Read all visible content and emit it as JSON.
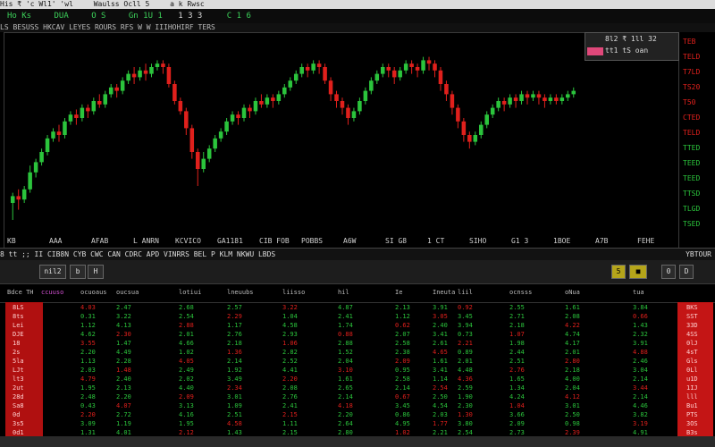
{
  "window": {
    "title_left": "His ₹ 'c Wl1' 'wl",
    "title_mid": "Waulss Ocll 5",
    "title_right": "a k Rwsc"
  },
  "menubar": {
    "items": [
      "Ho Ks",
      "DUA",
      "O S",
      "Gn 1U 1",
      "1 3 3",
      "C 1 6"
    ]
  },
  "subbar": {
    "text": "LS BESUSS HKCAV LEYES ROURS RFS W W IIIHOHIRF TERS"
  },
  "price_panel": {
    "line1": "8l2 ₹ 1ll 32",
    "line2": "tt1 tS oan"
  },
  "right_axis": {
    "labels": [
      "TEB",
      "TELD",
      "T7LD",
      "TS20",
      "T50",
      "CTED",
      "TELD",
      "TTED",
      "TEED",
      "TEED",
      "TTSD",
      "TLGD",
      "TSED"
    ]
  },
  "xaxis": {
    "labels": [
      "KB",
      "AAA",
      "AFAB",
      "L ANRN",
      "KCVICO",
      "GA1181",
      "CIB FOB",
      "POBBS",
      "A6W",
      "SI G8",
      "1 CT",
      "SIHO",
      "G1 3",
      "1BOE",
      "A7B",
      "FEHE"
    ]
  },
  "statusbar": {
    "text": "8 tt ;;  II CIB8N   CYB CWC CAN CDRC   APD VINRRS   BEL   P KLM NKWU  LBDS",
    "right": "YBTOUR"
  },
  "toolbar2": {
    "buttons": [
      "nil2",
      "b",
      "H"
    ],
    "right_buttons": [
      "5",
      "■",
      "0",
      "D"
    ]
  },
  "table": {
    "headers": [
      "Bdce TH",
      "ccuuso",
      "ocuoaus",
      "oucsua",
      "lotiui",
      "lneuubs",
      "liisso",
      "hil",
      "Ie",
      "Ineuta",
      "liil",
      "ocnsss",
      "oNua",
      "tua"
    ],
    "left_col": [
      "8LS",
      "8ts",
      "Lei",
      "DJE",
      "18",
      "2s",
      "5la",
      "LJt",
      "lt3",
      "2ut",
      "28d",
      "Sa8",
      "0d",
      "3s5",
      "0d1"
    ],
    "right_col": [
      "BKS",
      "SST",
      "33D",
      "4SS",
      "0lJ",
      "4sT",
      "Gls",
      "0Ll",
      "u1D",
      "1IJ",
      "lll",
      "Bu1",
      "PTS",
      "3OS",
      "B3s"
    ],
    "rows": [
      [
        "4.03",
        "2.47",
        "2.68",
        "2.57",
        "3.22",
        "4.87",
        "2.13",
        "3.91",
        "0.92",
        "2.55",
        "1.61",
        "3.84"
      ],
      [
        "0.31",
        "3.22",
        "2.54",
        "2.29",
        "1.04",
        "2.41",
        "1.12",
        "3.05",
        "3.45",
        "2.71",
        "2.08",
        "0.66"
      ],
      [
        "1.12",
        "4.13",
        "2.88",
        "1.17",
        "4.58",
        "1.74",
        "0.62",
        "2.40",
        "3.94",
        "2.18",
        "4.22",
        "1.43"
      ],
      [
        "4.62",
        "2.30",
        "2.01",
        "2.76",
        "2.93",
        "0.88",
        "2.07",
        "3.41",
        "0.73",
        "1.07",
        "4.74",
        "2.32"
      ],
      [
        "3.55",
        "1.47",
        "4.66",
        "2.18",
        "1.06",
        "2.88",
        "2.58",
        "2.61",
        "2.21",
        "1.98",
        "4.17",
        "3.91"
      ],
      [
        "2.20",
        "4.49",
        "1.02",
        "1.36",
        "2.82",
        "1.52",
        "2.38",
        "4.65",
        "0.89",
        "2.44",
        "2.01",
        "4.88"
      ],
      [
        "1.13",
        "2.28",
        "4.05",
        "2.14",
        "2.52",
        "2.04",
        "2.09",
        "1.61",
        "2.01",
        "2.51",
        "2.80",
        "2.46"
      ],
      [
        "2.03",
        "1.48",
        "2.49",
        "1.92",
        "4.41",
        "3.10",
        "0.95",
        "3.41",
        "4.48",
        "2.76",
        "2.18",
        "3.04"
      ],
      [
        "4.79",
        "2.40",
        "2.02",
        "3.49",
        "2.20",
        "1.61",
        "2.58",
        "1.14",
        "4.36",
        "1.65",
        "4.00",
        "2.14"
      ],
      [
        "1.95",
        "2.13",
        "4.40",
        "2.34",
        "2.08",
        "2.65",
        "2.14",
        "2.54",
        "2.59",
        "1.34",
        "2.04",
        "3.44"
      ],
      [
        "2.48",
        "2.20",
        "2.09",
        "3.01",
        "2.76",
        "2.14",
        "0.67",
        "2.50",
        "1.90",
        "4.24",
        "4.12",
        "2.14"
      ],
      [
        "0.43",
        "4.07",
        "3.13",
        "1.09",
        "2.41",
        "4.18",
        "3.45",
        "4.54",
        "2.30",
        "1.04",
        "3.01",
        "4.46"
      ],
      [
        "2.20",
        "2.72",
        "4.16",
        "2.51",
        "2.15",
        "2.20",
        "0.86",
        "2.03",
        "1.30",
        "3.66",
        "2.50",
        "3.82"
      ],
      [
        "3.09",
        "1.19",
        "1.95",
        "4.58",
        "1.11",
        "2.64",
        "4.95",
        "1.77",
        "3.80",
        "2.09",
        "0.98",
        "3.19"
      ],
      [
        "1.31",
        "4.01",
        "2.12",
        "1.43",
        "2.15",
        "2.80",
        "1.02",
        "2.21",
        "2.54",
        "2.73",
        "2.39",
        "4.91"
      ]
    ]
  },
  "colors": {
    "up": "#2bc43c",
    "down": "#e0201c",
    "panel_tag": "#e0487a",
    "red_col": "#c41515"
  },
  "chart_data": {
    "type": "candlestick",
    "candles": [
      [
        40,
        44,
        30,
        46
      ],
      [
        44,
        42,
        36,
        48
      ],
      [
        42,
        48,
        40,
        50
      ],
      [
        48,
        58,
        46,
        62
      ],
      [
        58,
        64,
        55,
        66
      ],
      [
        64,
        70,
        62,
        72
      ],
      [
        70,
        78,
        68,
        80
      ],
      [
        78,
        82,
        76,
        84
      ],
      [
        82,
        80,
        76,
        86
      ],
      [
        80,
        88,
        78,
        90
      ],
      [
        88,
        92,
        86,
        94
      ],
      [
        92,
        90,
        86,
        95
      ],
      [
        90,
        96,
        88,
        98
      ],
      [
        96,
        94,
        90,
        98
      ],
      [
        94,
        100,
        92,
        102
      ],
      [
        100,
        98,
        96,
        104
      ],
      [
        98,
        104,
        96,
        106
      ],
      [
        104,
        108,
        102,
        110
      ],
      [
        108,
        106,
        102,
        110
      ],
      [
        106,
        112,
        104,
        114
      ],
      [
        112,
        116,
        110,
        118
      ],
      [
        116,
        114,
        110,
        120
      ],
      [
        114,
        118,
        112,
        120
      ],
      [
        118,
        116,
        112,
        122
      ],
      [
        116,
        120,
        114,
        122
      ],
      [
        120,
        122,
        118,
        124
      ],
      [
        122,
        120,
        116,
        124
      ],
      [
        120,
        110,
        108,
        122
      ],
      [
        110,
        100,
        98,
        112
      ],
      [
        100,
        94,
        92,
        102
      ],
      [
        94,
        84,
        80,
        96
      ],
      [
        84,
        70,
        66,
        86
      ],
      [
        70,
        60,
        50,
        72
      ],
      [
        60,
        66,
        58,
        70
      ],
      [
        66,
        72,
        64,
        74
      ],
      [
        72,
        78,
        70,
        80
      ],
      [
        78,
        82,
        76,
        84
      ],
      [
        82,
        88,
        80,
        90
      ],
      [
        88,
        92,
        86,
        94
      ],
      [
        92,
        90,
        86,
        94
      ],
      [
        90,
        96,
        88,
        98
      ],
      [
        96,
        94,
        90,
        98
      ],
      [
        94,
        100,
        92,
        102
      ],
      [
        100,
        98,
        96,
        104
      ],
      [
        98,
        102,
        96,
        104
      ],
      [
        102,
        100,
        96,
        104
      ],
      [
        100,
        104,
        98,
        106
      ],
      [
        104,
        108,
        102,
        110
      ],
      [
        108,
        112,
        106,
        114
      ],
      [
        112,
        116,
        110,
        118
      ],
      [
        116,
        120,
        114,
        122
      ],
      [
        120,
        118,
        114,
        122
      ],
      [
        118,
        122,
        116,
        124
      ],
      [
        122,
        120,
        116,
        124
      ],
      [
        120,
        112,
        110,
        122
      ],
      [
        112,
        104,
        100,
        114
      ],
      [
        104,
        100,
        96,
        106
      ],
      [
        100,
        96,
        92,
        102
      ],
      [
        96,
        90,
        86,
        98
      ],
      [
        90,
        94,
        88,
        96
      ],
      [
        94,
        100,
        92,
        102
      ],
      [
        100,
        106,
        98,
        108
      ],
      [
        106,
        112,
        104,
        114
      ],
      [
        112,
        116,
        110,
        118
      ],
      [
        116,
        120,
        114,
        122
      ],
      [
        120,
        118,
        114,
        122
      ],
      [
        118,
        114,
        110,
        120
      ],
      [
        114,
        118,
        112,
        120
      ],
      [
        118,
        122,
        116,
        124
      ],
      [
        122,
        120,
        116,
        124
      ],
      [
        120,
        118,
        114,
        122
      ],
      [
        118,
        124,
        116,
        126
      ],
      [
        124,
        122,
        118,
        126
      ],
      [
        122,
        118,
        114,
        124
      ],
      [
        118,
        110,
        106,
        120
      ],
      [
        110,
        104,
        100,
        112
      ],
      [
        104,
        96,
        92,
        106
      ],
      [
        96,
        88,
        84,
        98
      ],
      [
        88,
        80,
        76,
        90
      ],
      [
        80,
        76,
        72,
        82
      ],
      [
        76,
        80,
        74,
        82
      ],
      [
        80,
        86,
        78,
        88
      ],
      [
        86,
        92,
        84,
        94
      ],
      [
        92,
        96,
        90,
        98
      ],
      [
        96,
        100,
        94,
        102
      ],
      [
        100,
        98,
        94,
        102
      ],
      [
        98,
        102,
        96,
        104
      ],
      [
        102,
        100,
        96,
        104
      ],
      [
        100,
        104,
        98,
        106
      ],
      [
        104,
        102,
        98,
        106
      ],
      [
        102,
        104,
        100,
        106
      ],
      [
        104,
        102,
        98,
        106
      ],
      [
        102,
        100,
        96,
        104
      ],
      [
        100,
        102,
        98,
        104
      ],
      [
        102,
        100,
        98,
        104
      ],
      [
        100,
        102,
        98,
        104
      ],
      [
        102,
        104,
        100,
        106
      ],
      [
        104,
        106,
        102,
        108
      ]
    ],
    "ylim": [
      20,
      140
    ]
  }
}
